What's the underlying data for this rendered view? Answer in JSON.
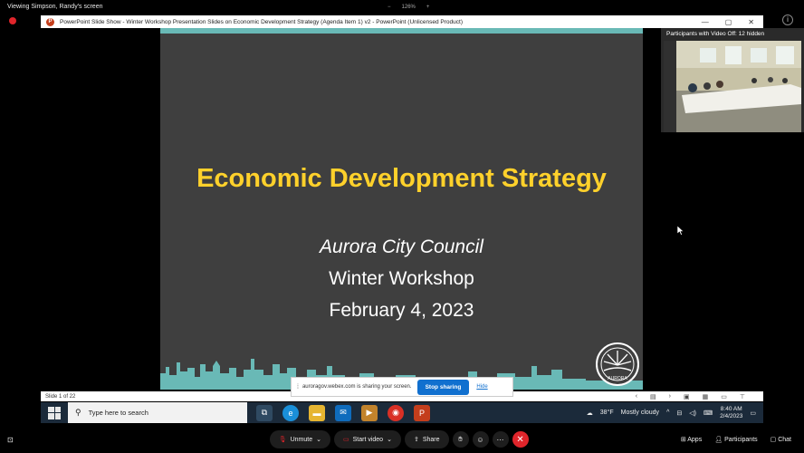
{
  "header": {
    "viewing_text": "Viewing Simpson, Randy's screen",
    "zoom_minus": "−",
    "zoom_level": "126%",
    "zoom_plus": "+"
  },
  "ppt_window": {
    "title": "PowerPoint Slide Show  -  Winter Workshop Presentation Slides on Economic Development Strategy (Agenda Item 1) v2 - PowerPoint (Unlicensed Product)",
    "logo_letter": "P",
    "status": {
      "slide_num": "Slide 1 of 22"
    }
  },
  "slide": {
    "title": "Economic Development Strategy",
    "line1": "Aurora City Council",
    "line2": "Winter Workshop",
    "line3": "February 4, 2023",
    "seal_text": "AURORA"
  },
  "participants": {
    "label": "Participants with Video Off:  12 hidden"
  },
  "share_notice": {
    "text": "auroragov.webex.com is sharing your screen.",
    "stop_label": "Stop sharing",
    "hide_label": "Hide"
  },
  "taskbar": {
    "search_placeholder": "Type here to search",
    "weather_temp": "38°F",
    "weather_desc": "Mostly cloudy",
    "time": "8:40 AM",
    "date": "2/4/2023"
  },
  "meeting_controls": {
    "unmute": "Unmute",
    "start_video": "Start video",
    "share": "Share",
    "apps": "Apps",
    "participants": "Participants",
    "chat": "Chat"
  },
  "colors": {
    "slide_bg": "#3f3f3f",
    "slide_title": "#ffd12b",
    "accent_teal": "#69b9b6",
    "stop_button": "#1170cf",
    "end_button": "#e0252b"
  }
}
